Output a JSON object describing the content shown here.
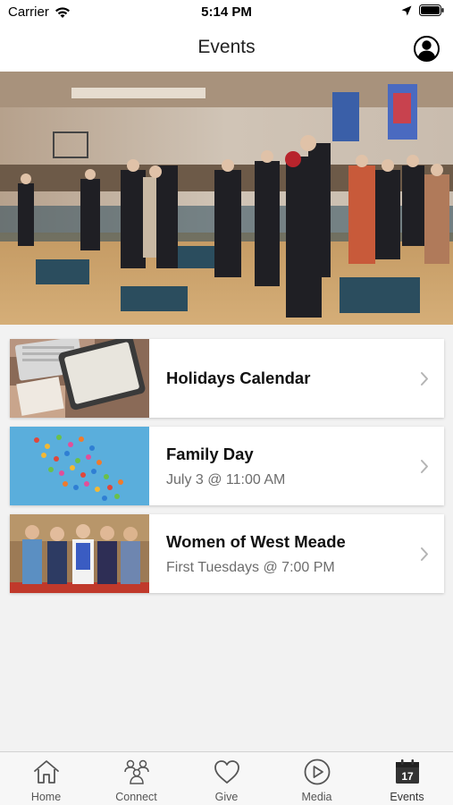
{
  "status_bar": {
    "carrier": "Carrier",
    "time": "5:14 PM"
  },
  "header": {
    "title": "Events"
  },
  "events": [
    {
      "title": "Holidays Calendar",
      "subtitle": ""
    },
    {
      "title": "Family Day",
      "subtitle": "July 3 @ 11:00 AM"
    },
    {
      "title": "Women of West Meade",
      "subtitle": "First Tuesdays @ 7:00 PM"
    }
  ],
  "tab_bar": {
    "items": [
      {
        "label": "Home",
        "icon": "home-icon"
      },
      {
        "label": "Connect",
        "icon": "people-icon"
      },
      {
        "label": "Give",
        "icon": "heart-icon"
      },
      {
        "label": "Media",
        "icon": "play-icon"
      },
      {
        "label": "Events",
        "icon": "calendar-icon",
        "badge": "17"
      }
    ],
    "selected": "Events"
  },
  "colors": {
    "active_tab": "#333333",
    "inactive_tab": "#555555",
    "subtitle": "#6d6d6d"
  }
}
